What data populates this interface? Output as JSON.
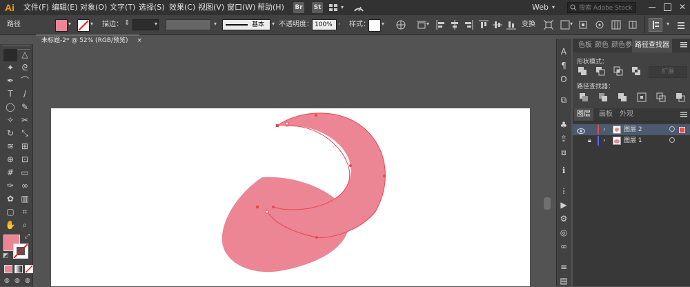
{
  "app": {
    "logo": "Ai"
  },
  "menu": [
    "文件(F)",
    "编辑(E)",
    "对象(O)",
    "文字(T)",
    "选择(S)",
    "效果(C)",
    "视图(V)",
    "窗口(W)",
    "帮助(H)"
  ],
  "menu_buttons": [
    "Br",
    "St"
  ],
  "workspace": "Web",
  "search": {
    "placeholder": "搜索 Adobe Stock"
  },
  "control_bar": {
    "object_type": "路径",
    "fill_color": "#ee8594",
    "stroke_label": "描边：",
    "stroke_style": "基本",
    "opacity_label": "不透明度：",
    "opacity_value": "100%",
    "style_label": "样式：",
    "transform_label": "变换"
  },
  "document_tab": {
    "title": "未标题-2* @ 52% (RGB/预览)",
    "close": "×"
  },
  "left_tools": [
    "selection-tool",
    "direct-selection-tool",
    "magic-wand-tool",
    "lasso-tool",
    "pen-tool",
    "curvature-tool",
    "type-tool",
    "line-tool",
    "ellipse-tool",
    "paintbrush-tool",
    "shaper-tool",
    "scissors-tool",
    "rotate-tool",
    "scale-tool",
    "width-tool",
    "free-transform-tool",
    "shape-builder-tool",
    "perspective-tool",
    "mesh-tool",
    "gradient-tool",
    "eyedropper-tool",
    "blend-tool",
    "symbol-sprayer-tool",
    "graph-tool",
    "artboard-tool",
    "slice-tool",
    "hand-tool",
    "zoom-tool"
  ],
  "colors": {
    "fill": "#ee8594",
    "shape": "#ec8594",
    "selection": "#e8484f"
  },
  "panel_tabs": [
    "色板",
    "颜色",
    "颜色参",
    "路径查找器"
  ],
  "pathfinder": {
    "shape_modes_label": "形状模式：",
    "pathfinders_label": "路径查找器：",
    "expand_label": "扩展"
  },
  "layers_panel": {
    "tabs": [
      "图层",
      "画板",
      "外观"
    ],
    "layers": [
      {
        "name": "图层 2",
        "color": "#e8484f",
        "selected": true
      },
      {
        "name": "图层 1",
        "color": "#4f6cff",
        "selected": false
      }
    ]
  }
}
